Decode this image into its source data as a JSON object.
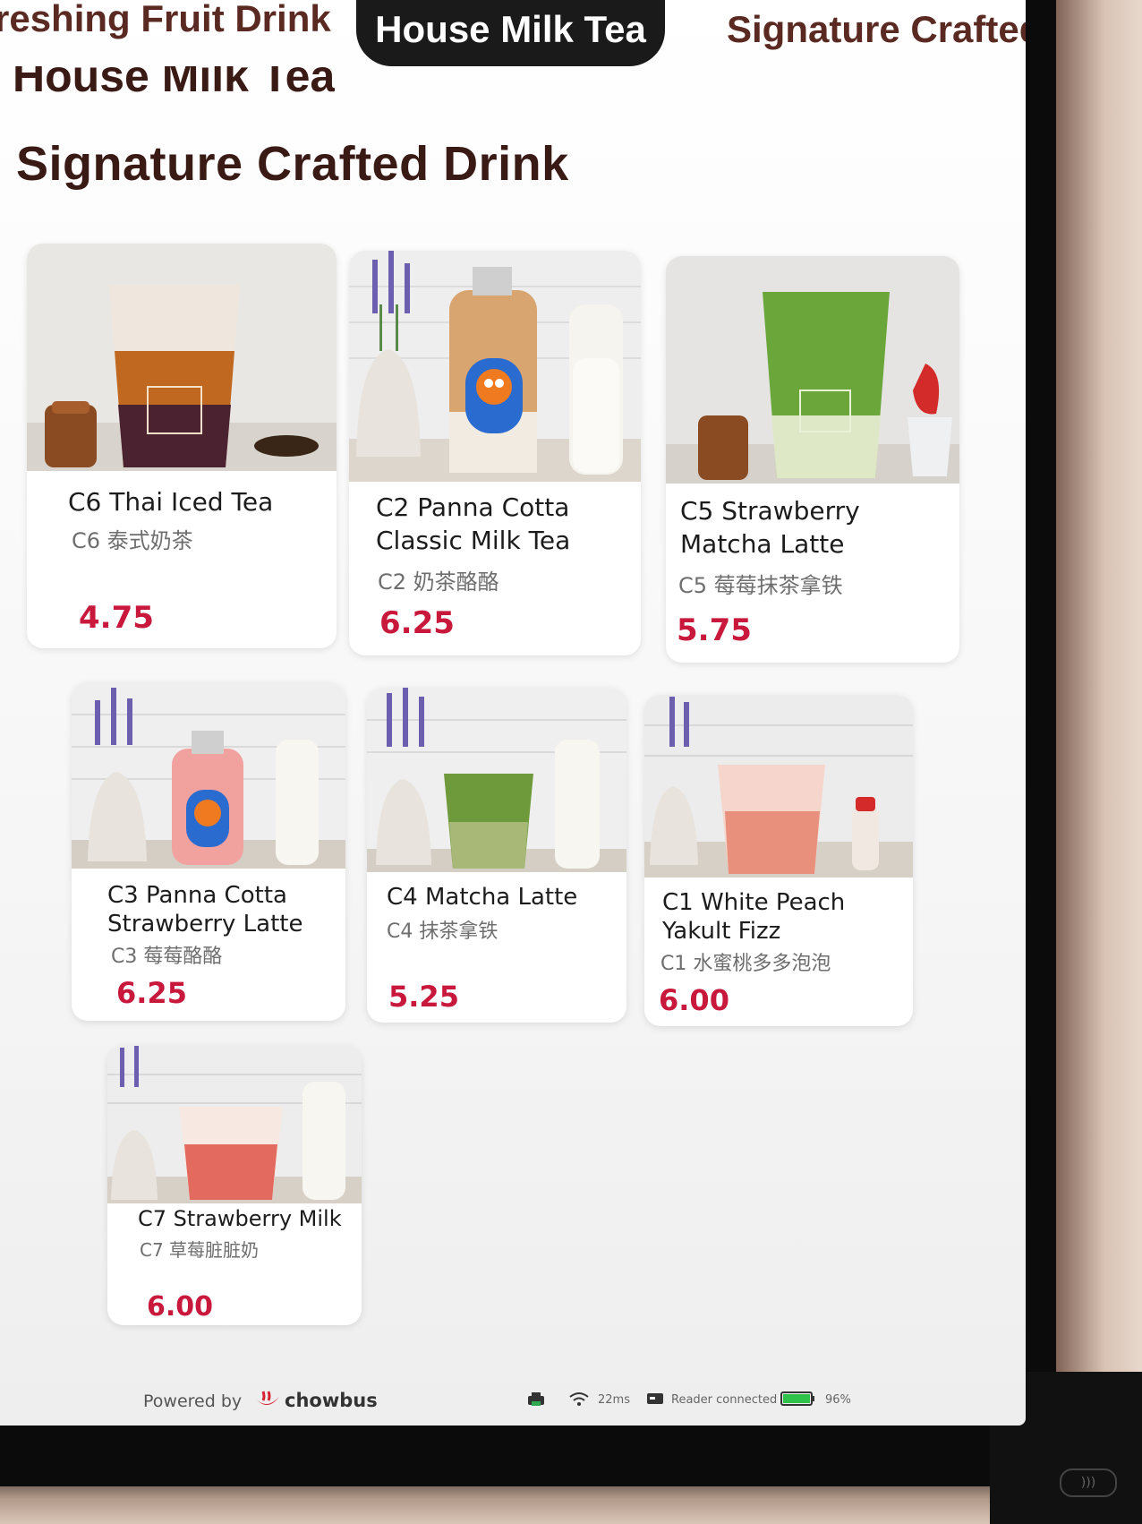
{
  "tabs": [
    {
      "label": "reshing Fruit Drink"
    },
    {
      "label": "House Milk Tea"
    },
    {
      "label": "Signature Crafted D"
    }
  ],
  "sections": {
    "previous_title": "House Milk Tea",
    "title": "Signature Crafted Drink"
  },
  "items": [
    {
      "name_l1": "C6 Thai Iced Tea",
      "name_l2": "",
      "cn": "C6 泰式奶茶",
      "price": "4.75"
    },
    {
      "name_l1": "C2 Panna Cotta",
      "name_l2": "Classic Milk Tea",
      "cn": "C2 奶茶酪酪",
      "price": "6.25"
    },
    {
      "name_l1": "C5 Strawberry",
      "name_l2": "Matcha Latte",
      "cn": "C5 莓莓抹茶拿铁",
      "price": "5.75"
    },
    {
      "name_l1": "C3 Panna Cotta",
      "name_l2": "Strawberry Latte",
      "cn": "C3 莓莓酪酪",
      "price": "6.25"
    },
    {
      "name_l1": "C4 Matcha Latte",
      "name_l2": "",
      "cn": "C4 抹茶拿铁",
      "price": "5.25"
    },
    {
      "name_l1": "C1 White Peach",
      "name_l2": "Yakult Fizz",
      "cn": "C1 水蜜桃多多泡泡",
      "price": "6.00"
    },
    {
      "name_l1": "C7 Strawberry Milk",
      "name_l2": "",
      "cn": "C7 草莓脏脏奶",
      "price": "6.00"
    }
  ],
  "footer": {
    "powered_by": "Powered by",
    "brand": "chowbus",
    "latency": "22ms",
    "reader": "Reader connected",
    "battery": "96%"
  },
  "colors": {
    "price": "#c8193c",
    "active_tab_bg": "#1a1a1a",
    "brand_red": "#d6202e"
  }
}
